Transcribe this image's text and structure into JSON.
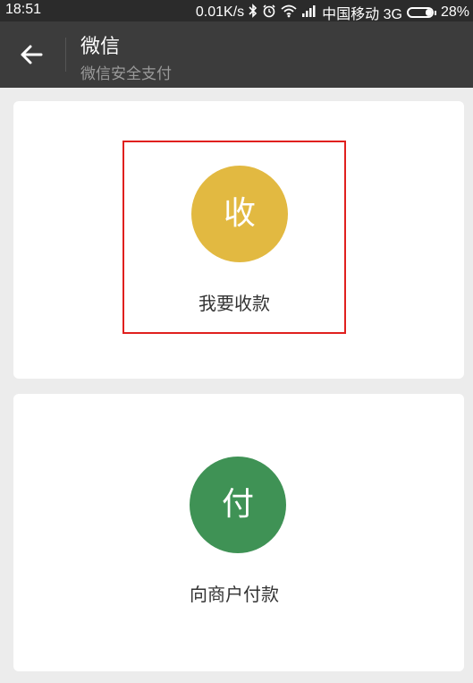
{
  "status_bar": {
    "time": "18:51",
    "speed": "0.01K/s",
    "bluetooth_icon": "bluetooth-icon",
    "alarm_icon": "alarm-icon",
    "wifi_icon": "wifi-icon",
    "signal_icon": "signal-icon",
    "carrier": "中国移动 3G",
    "battery_percent": "28%",
    "battery_level": 0.28
  },
  "header": {
    "back_icon": "arrow-left-icon",
    "title": "微信",
    "subtitle": "微信安全支付"
  },
  "actions": [
    {
      "icon_char": "收",
      "label": "我要收款",
      "color": "#e2b941",
      "highlighted": true
    },
    {
      "icon_char": "付",
      "label": "向商户付款",
      "color": "#3f9255",
      "highlighted": false
    }
  ],
  "colors": {
    "status_bar_bg": "#2b2b2b",
    "title_bar_bg": "#3c3c3c",
    "page_bg": "#ececec",
    "highlight_border": "#e0201e"
  }
}
